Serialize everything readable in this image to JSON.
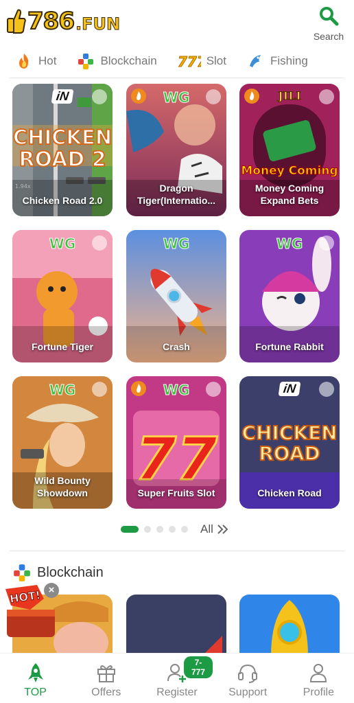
{
  "header": {
    "logo_number": "786",
    "logo_suffix": ".FUN",
    "search_label": "Search"
  },
  "tabs": [
    {
      "label": "Hot",
      "icon": "flame-icon"
    },
    {
      "label": "Blockchain",
      "icon": "blockchain-icon"
    },
    {
      "label": "Slot",
      "icon": "slot-777-icon"
    },
    {
      "label": "Fishing",
      "icon": "fish-icon"
    }
  ],
  "games": [
    {
      "title": "Chicken Road 2.0",
      "brand": "iN",
      "art_text": "CHICKEN ROAD 2",
      "tag": "1.94x"
    },
    {
      "title": "Dragon Tiger(Internatio...",
      "brand": "WG"
    },
    {
      "title": "Money Coming Expand Bets",
      "brand": "JILI",
      "art_text": "Money Coming"
    },
    {
      "title": "Fortune Tiger",
      "brand": "WG"
    },
    {
      "title": "Crash",
      "brand": "WG"
    },
    {
      "title": "Fortune Rabbit",
      "brand": "WG"
    },
    {
      "title": "Wild Bounty Showdown",
      "brand": "WG"
    },
    {
      "title": "Super Fruits Slot",
      "brand": "WG"
    },
    {
      "title": "Chicken Road",
      "brand": "iN",
      "art_text": "CHICKEN ROAD"
    }
  ],
  "pager": {
    "all_label": "All"
  },
  "section": {
    "title": "Blockchain",
    "icon": "blockchain-icon"
  },
  "promo": {
    "text": "HOT!",
    "close": "×"
  },
  "bottom_nav": [
    {
      "label": "TOP",
      "icon": "rocket-icon",
      "active": true
    },
    {
      "label": "Offers",
      "icon": "gift-icon"
    },
    {
      "label": "Register",
      "icon": "add-user-icon",
      "badge": "7-777"
    },
    {
      "label": "Support",
      "icon": "headset-icon"
    },
    {
      "label": "Profile",
      "icon": "user-icon"
    }
  ],
  "colors": {
    "accent": "#1d9a44",
    "logo_gold": "#f5c21b"
  }
}
